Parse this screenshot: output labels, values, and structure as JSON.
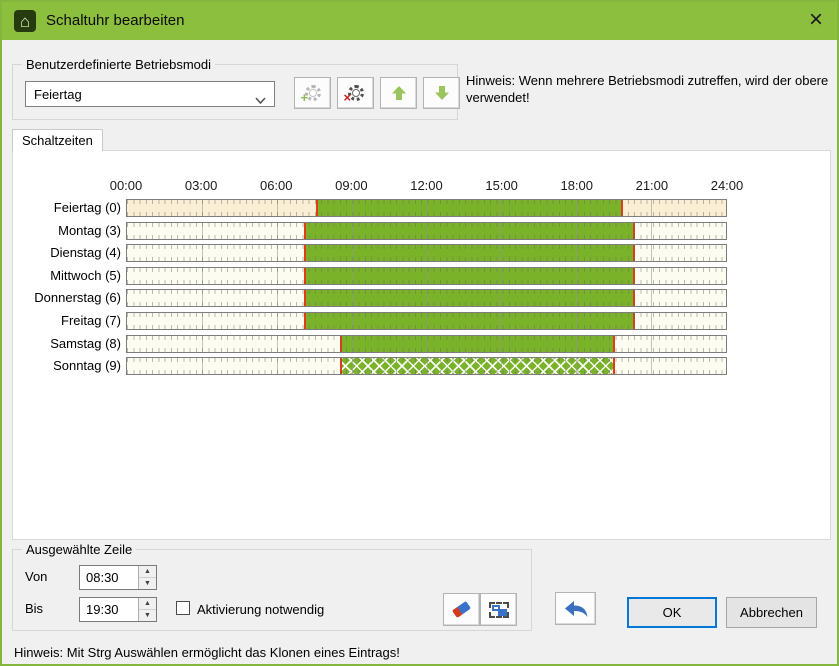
{
  "window": {
    "title": "Schaltuhr bearbeiten",
    "close_glyph": "×"
  },
  "colors": {
    "titlebar_green": "#8dbf3e",
    "bar_green": "#7ab22a",
    "marker_red": "#e23a1b",
    "selected_row_bg": "#faefd5",
    "row_bg": "#fcfcf0",
    "focus_blue": "#0078d7"
  },
  "betriebsmodi": {
    "group_label": "Benutzerdefinierte Betriebsmodi",
    "selected_option": "Feiertag",
    "hint": "Hinweis: Wenn mehrere Betriebsmodi zutreffen, wird der obere verwendet!"
  },
  "tabs": {
    "active": "Schaltzeiten"
  },
  "chart_data": {
    "type": "bar",
    "title": "Schaltzeiten",
    "x_axis": {
      "ticks": [
        "00:00",
        "03:00",
        "06:00",
        "09:00",
        "12:00",
        "15:00",
        "18:00",
        "21:00",
        "24:00"
      ],
      "min_h": 0,
      "max_h": 24
    },
    "rows": [
      {
        "label": "Feiertag (0)",
        "start": "07:35",
        "end": "19:45",
        "start_h": 7.62,
        "end_h": 19.82,
        "selected": true,
        "pattern": "solid"
      },
      {
        "label": "Montag (3)",
        "start": "07:05",
        "end": "20:20",
        "start_h": 7.12,
        "end_h": 20.32,
        "selected": false,
        "pattern": "solid"
      },
      {
        "label": "Dienstag (4)",
        "start": "07:05",
        "end": "20:20",
        "start_h": 7.12,
        "end_h": 20.32,
        "selected": false,
        "pattern": "solid"
      },
      {
        "label": "Mittwoch (5)",
        "start": "07:05",
        "end": "20:20",
        "start_h": 7.12,
        "end_h": 20.32,
        "selected": false,
        "pattern": "solid"
      },
      {
        "label": "Donnerstag (6)",
        "start": "07:05",
        "end": "20:20",
        "start_h": 7.12,
        "end_h": 20.32,
        "selected": false,
        "pattern": "solid"
      },
      {
        "label": "Freitag (7)",
        "start": "07:05",
        "end": "20:20",
        "start_h": 7.12,
        "end_h": 20.32,
        "selected": false,
        "pattern": "solid"
      },
      {
        "label": "Samstag (8)",
        "start": "08:30",
        "end": "19:30",
        "start_h": 8.57,
        "end_h": 19.5,
        "selected": false,
        "pattern": "solid"
      },
      {
        "label": "Sonntag (9)",
        "start": "08:30",
        "end": "19:30",
        "start_h": 8.57,
        "end_h": 19.5,
        "selected": false,
        "pattern": "crosshatch"
      }
    ]
  },
  "ausgewaehlte_zeile": {
    "group_label": "Ausgewählte Zeile",
    "von_label": "Von",
    "von_value": "08:30",
    "bis_label": "Bis",
    "bis_value": "19:30",
    "checkbox_label": "Aktivierung notwendig",
    "checkbox_checked": false
  },
  "actions": {
    "ok": "OK",
    "cancel": "Abbrechen"
  },
  "footer_hint": "Hinweis: Mit Strg Auswählen ermöglicht das Klonen eines Eintrags!"
}
